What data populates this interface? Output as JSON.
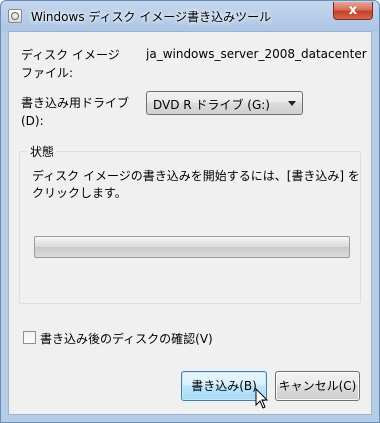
{
  "window": {
    "title": "Windows ディスク イメージ書き込みツール",
    "close_glyph": "x"
  },
  "form": {
    "disc_image_label_line1": "ディスク イメージ",
    "disc_image_label_line2": "ファイル:",
    "disc_image_value": "ja_windows_server_2008_datacenter",
    "drive_label_line1": "書き込み用ドライブ",
    "drive_label_line2": "(D):",
    "drive_selected": "DVD R ドライブ (G:)"
  },
  "status": {
    "group_title": "状態",
    "message": "ディスク イメージの書き込みを開始するには、[書き込み] をクリックします。",
    "progress_fraction": 0
  },
  "verify": {
    "label": "書き込み後のディスクの確認(V)",
    "checked": false
  },
  "buttons": {
    "write_label": "書き込み(B)",
    "cancel_label": "キャンセル(C)"
  },
  "icons": {
    "title_icon": "disc-burner-icon",
    "dropdown": "chevron-down-icon",
    "cursor": "mouse-pointer-icon"
  }
}
